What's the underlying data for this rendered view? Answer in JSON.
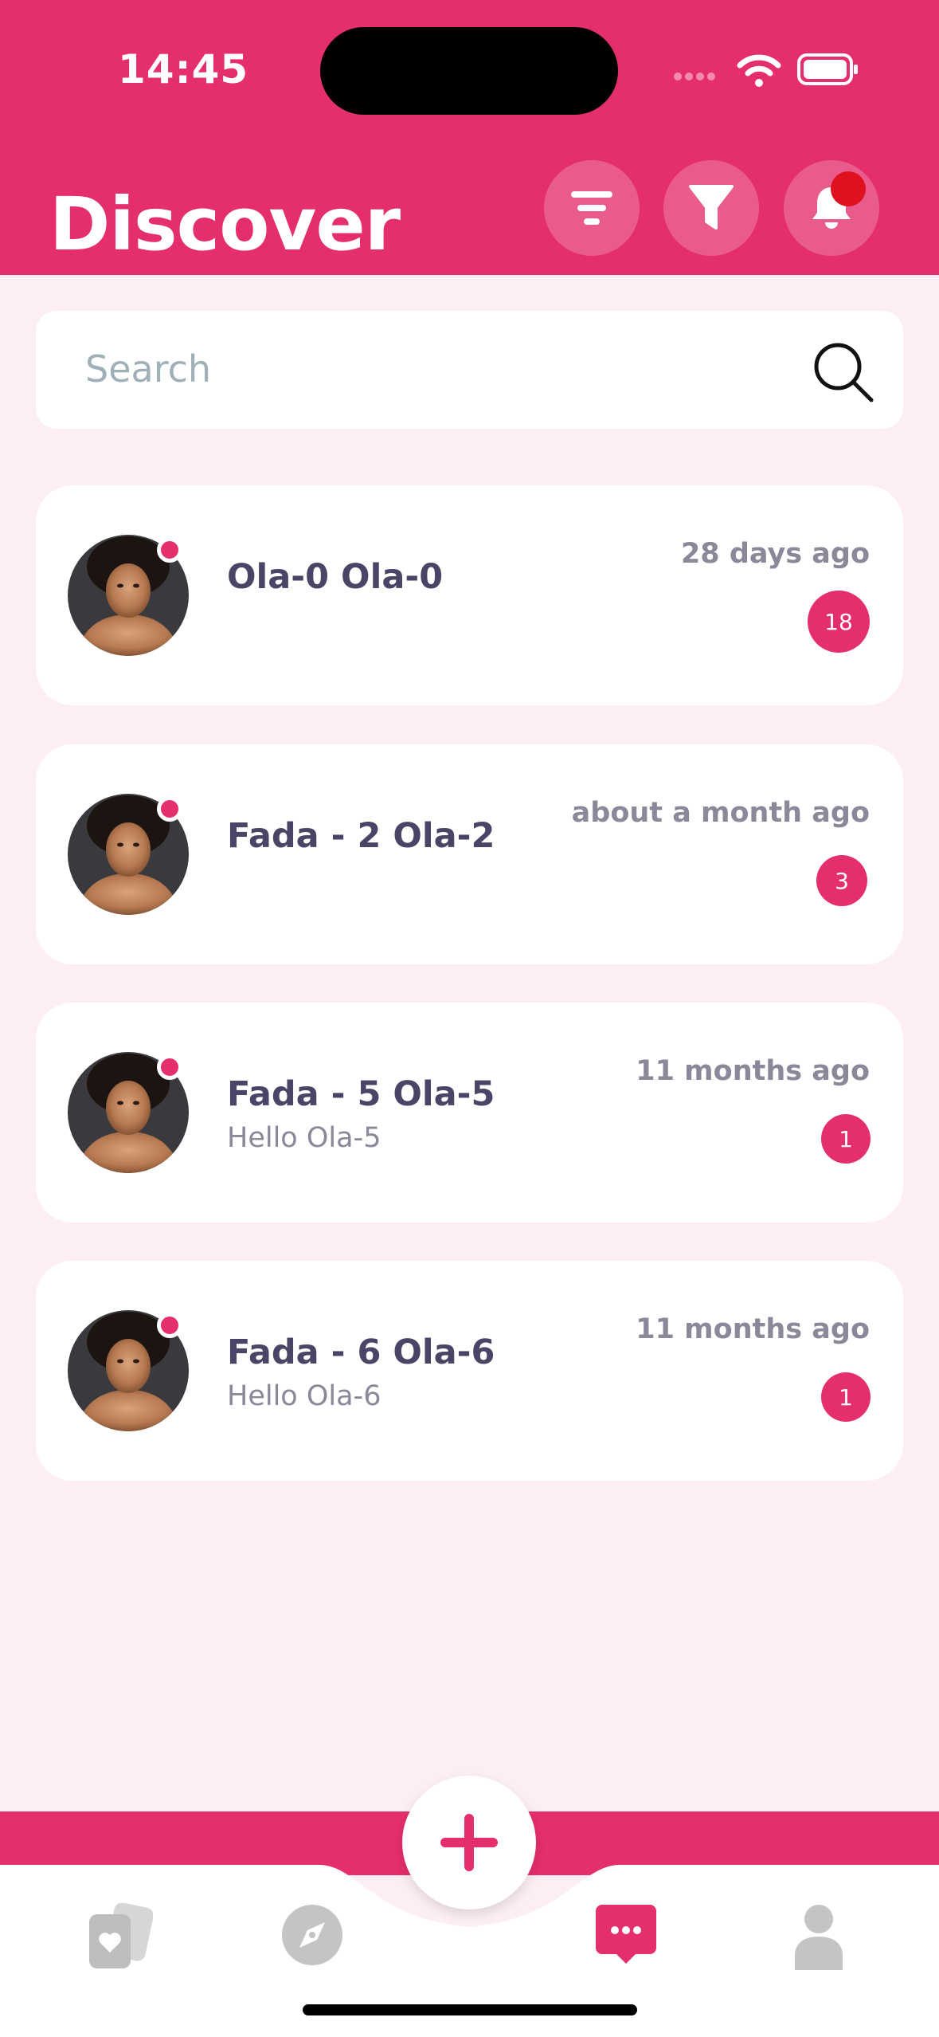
{
  "status_bar": {
    "time": "14:45"
  },
  "header": {
    "title": "Discover"
  },
  "search": {
    "placeholder": "Search"
  },
  "conversations": [
    {
      "name": "Ola-0 Ola-0",
      "preview": "",
      "time": "28 days ago",
      "unread": "18"
    },
    {
      "name": "Fada - 2 Ola-2",
      "preview": "",
      "time": "about a month ago",
      "unread": "3"
    },
    {
      "name": "Fada - 5 Ola-5",
      "preview": "Hello Ola-5",
      "time": "11 months ago",
      "unread": "1"
    },
    {
      "name": "Fada - 6 Ola-6",
      "preview": "Hello Ola-6",
      "time": "11 months ago",
      "unread": "1"
    }
  ],
  "tabs": [
    {
      "icon": "cards-heart-icon",
      "active": false
    },
    {
      "icon": "compass-icon",
      "active": false
    },
    {
      "icon": "chat-bubble-icon",
      "active": true
    },
    {
      "icon": "profile-icon",
      "active": false
    }
  ],
  "colors": {
    "accent": "#e52e6d",
    "background": "#fdeef4",
    "notification": "#e0111f"
  }
}
